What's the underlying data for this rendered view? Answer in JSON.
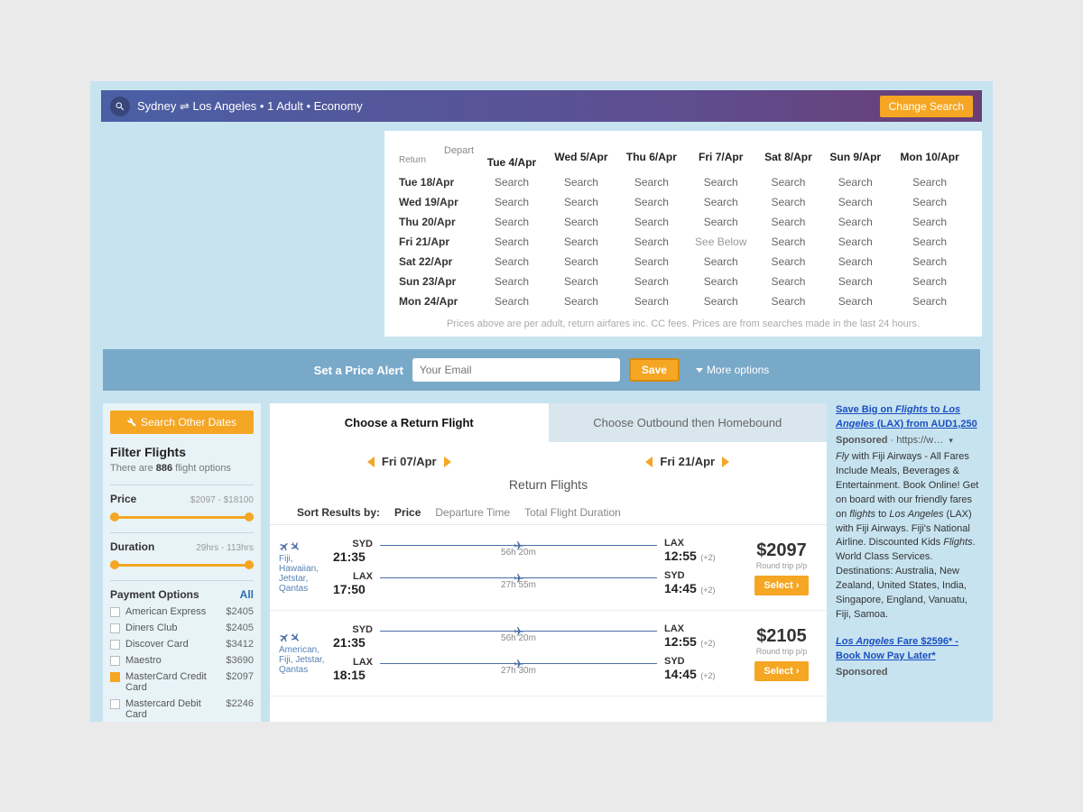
{
  "topbar": {
    "summary": "Sydney ⇌ Los Angeles • 1 Adult • Economy",
    "change_label": "Change Search"
  },
  "matrix": {
    "corner_depart": "Depart",
    "corner_return": "Return",
    "depart_cols": [
      "Tue 4/Apr",
      "Wed 5/Apr",
      "Thu 6/Apr",
      "Fri 7/Apr",
      "Sat 8/Apr",
      "Sun 9/Apr",
      "Mon 10/Apr"
    ],
    "return_rows": [
      "Tue 18/Apr",
      "Wed 19/Apr",
      "Thu 20/Apr",
      "Fri 21/Apr",
      "Sat 22/Apr",
      "Sun 23/Apr",
      "Mon 24/Apr"
    ],
    "cell_default": "Search",
    "cell_selected": "See Below",
    "footer": "Prices above are per adult, return airfares inc. CC fees. Prices are from searches made in the last 24 hours."
  },
  "alert": {
    "label": "Set a Price Alert",
    "placeholder": "Your Email",
    "save": "Save",
    "more": "More options"
  },
  "sidebar": {
    "other_dates": "Search Other Dates",
    "filter_title": "Filter Flights",
    "count_num": "886",
    "count_text": "flight options",
    "price_label": "Price",
    "price_range": "$2097 - $18100",
    "duration_label": "Duration",
    "duration_range": "29hrs - 113hrs",
    "payment_label": "Payment Options",
    "payment_all": "All",
    "payments": [
      {
        "name": "American Express",
        "price": "$2405",
        "checked": false
      },
      {
        "name": "Diners Club",
        "price": "$2405",
        "checked": false
      },
      {
        "name": "Discover Card",
        "price": "$3412",
        "checked": false
      },
      {
        "name": "Maestro",
        "price": "$3690",
        "checked": false
      },
      {
        "name": "MasterCard Credit Card",
        "price": "$2097",
        "checked": true
      },
      {
        "name": "Mastercard Debit Card",
        "price": "$2246",
        "checked": false
      }
    ]
  },
  "main": {
    "tab_active": "Choose a Return Flight",
    "tab_inactive": "Choose Outbound then Homebound",
    "date_out": "Fri 07/Apr",
    "date_ret": "Fri 21/Apr",
    "section": "Return Flights",
    "sort_label": "Sort Results by:",
    "sort_options": [
      "Price",
      "Departure Time",
      "Total Flight Duration"
    ],
    "sort_active": "Price",
    "select_label": "Select  ›",
    "price_sub": "Round trip p/p",
    "flights": [
      {
        "carriers": "Fiji, Hawaiian, Jetstar, Qantas",
        "leg_out": {
          "from": "SYD",
          "dep": "21:35",
          "dur": "56h 20m",
          "to": "LAX",
          "arr": "12:55",
          "day": "(+2)"
        },
        "leg_ret": {
          "from": "LAX",
          "dep": "17:50",
          "dur": "27h 55m",
          "to": "SYD",
          "arr": "14:45",
          "day": "(+2)"
        },
        "price": "$2097"
      },
      {
        "carriers": "American, Fiji, Jetstar, Qantas",
        "leg_out": {
          "from": "SYD",
          "dep": "21:35",
          "dur": "56h 20m",
          "to": "LAX",
          "arr": "12:55",
          "day": "(+2)"
        },
        "leg_ret": {
          "from": "LAX",
          "dep": "18:15",
          "dur": "27h 30m",
          "to": "SYD",
          "arr": "14:45",
          "day": "(+2)"
        },
        "price": "$2105"
      }
    ]
  },
  "ads": {
    "ad1_title_parts": [
      "Save Big on ",
      "Flights",
      " to ",
      "Los Angeles",
      " (LAX) from AUD1,250"
    ],
    "sponsored": "Sponsored",
    "url_stub": "https://w…",
    "drop": "▾",
    "ad1_body_1": "Fly",
    "ad1_body_2": " with Fiji Airways - All Fares Include Meals, Beverages & Entertainment. Book Online! Get on board with our friendly fares on ",
    "ad1_body_3": "flights",
    "ad1_body_4": " to ",
    "ad1_body_5": "Los Angeles",
    "ad1_body_6": " (LAX) with Fiji Airways. Fiji's National Airline. Discounted Kids ",
    "ad1_body_7": "Flights",
    "ad1_body_8": ". World Class Services. Destinations: Australia, New Zealand, United States, India, Singapore, England, Vanuatu, Fiji, Samoa.",
    "ad2_title_1": "Los Angeles",
    "ad2_title_2": " Fare $2596* - Book Now Pay Later*",
    "ad2_sponsored": "Sponsored"
  }
}
